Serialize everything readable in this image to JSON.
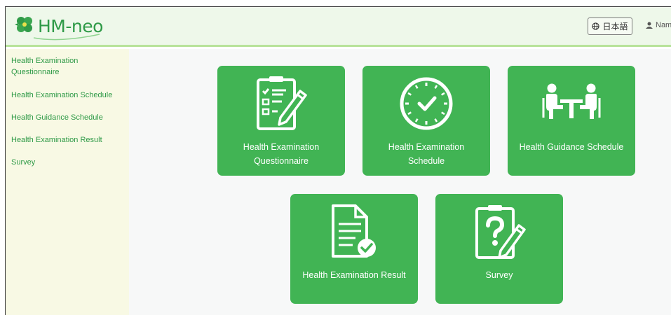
{
  "header": {
    "logo_text": "HM-neo",
    "language_label": "日本語",
    "user_label": "Nam"
  },
  "sidebar": {
    "items": [
      {
        "label": "Health Examination Questionnaire"
      },
      {
        "label": "Health Examination Schedule"
      },
      {
        "label": "Health Guidance Schedule"
      },
      {
        "label": "Health Examination Result"
      },
      {
        "label": "Survey"
      }
    ]
  },
  "tiles": [
    {
      "label_line1": "Health Examination",
      "label_line2": "Questionnaire",
      "icon": "questionnaire-clipboard-icon"
    },
    {
      "label_line1": "Health Examination",
      "label_line2": "Schedule",
      "icon": "clock-icon"
    },
    {
      "label_line1": "Health Guidance Schedule",
      "icon": "meeting-table-icon"
    },
    {
      "label_line1": "Health Examination Result",
      "icon": "document-check-icon"
    },
    {
      "label_line1": "Survey",
      "icon": "survey-clipboard-icon"
    }
  ],
  "colors": {
    "brand_green": "#41b454",
    "logo_green": "#2f9a47",
    "header_bg": "#eef8ea",
    "sidebar_bg": "#f8f9e4",
    "main_bg": "#f7f8f8"
  }
}
